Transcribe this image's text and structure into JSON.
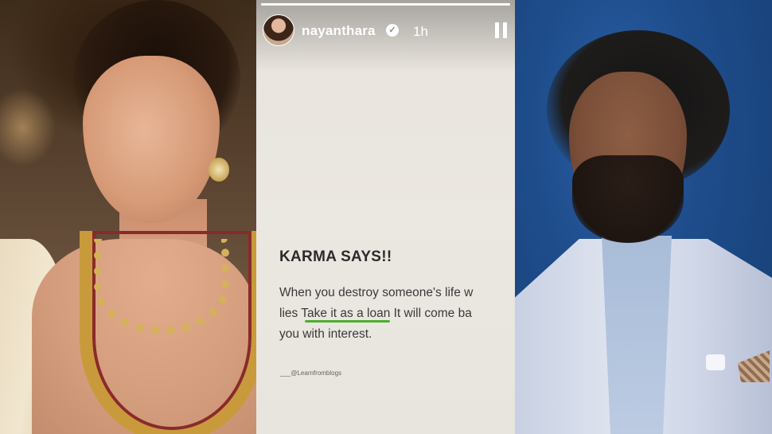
{
  "story": {
    "username": "nayanthara",
    "time_ago": "1h",
    "progress": 1.0,
    "title": "KARMA SAYS!!",
    "line1": "When you destroy someone's life w",
    "line2_pre": "lies ",
    "line2_highlight": "Take it as a loan",
    "line2_post": " It will come ba",
    "line3": "you with interest.",
    "credit": "___@Learnfromblogs",
    "verified_icon": "verified-badge-icon",
    "pause_icon": "pause-icon"
  },
  "colors": {
    "highlight_underline": "#4caf2e",
    "story_background": "#e9e4dd",
    "right_background": "#1e4c8b"
  }
}
